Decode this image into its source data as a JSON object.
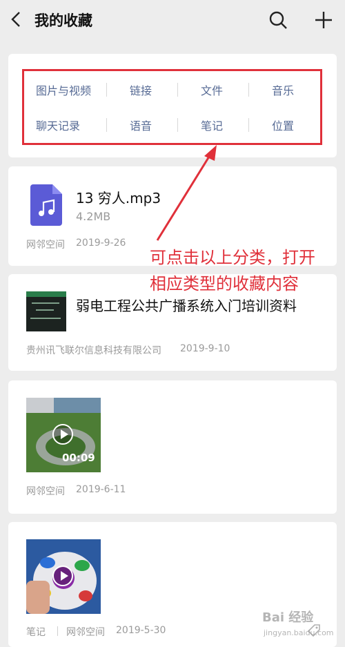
{
  "header": {
    "title": "我的收藏",
    "back_icon": "chevron-left-icon",
    "search_icon": "search-icon",
    "add_icon": "plus-icon"
  },
  "categories": {
    "row1": [
      "图片与视频",
      "链接",
      "文件",
      "音乐"
    ],
    "row2": [
      "聊天记录",
      "语音",
      "笔记",
      "位置"
    ]
  },
  "annotation": {
    "line1": "可点击以上分类，打开",
    "line2": "相应类型的收藏内容",
    "color": "#e0303a"
  },
  "items": [
    {
      "type": "file",
      "name": "13  穷人.mp3",
      "size": "4.2MB",
      "source": "网邻空间",
      "date": "2019-9-26",
      "icon": "music-file-icon",
      "icon_color": "#5b5bd6"
    },
    {
      "type": "link",
      "title": "弱电工程公共广播系统入门培训资料",
      "source": "贵州讯飞联尔信息科技有限公司",
      "date": "2019-9-10"
    },
    {
      "type": "video",
      "duration": "00:09",
      "source": "网邻空间",
      "date": "2019-6-11"
    },
    {
      "type": "note",
      "tag": "笔记",
      "source": "网邻空间",
      "date": "2019-5-30"
    }
  ],
  "watermark": {
    "text": "Bai 经验",
    "sub": "jingyan.baidu.com"
  }
}
